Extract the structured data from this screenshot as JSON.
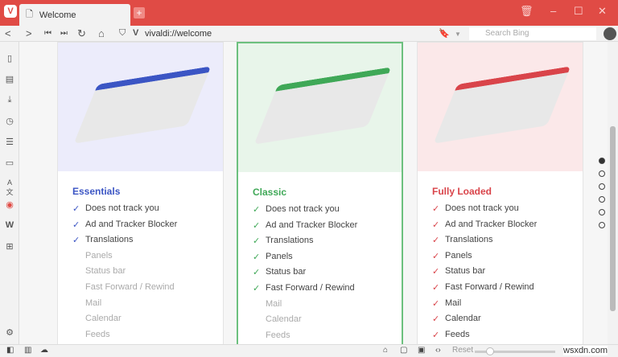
{
  "tab": {
    "title": "Welcome"
  },
  "address": {
    "url": "vivaldi://welcome",
    "search_placeholder": "Search Bing"
  },
  "cards": [
    {
      "title": "Essentials",
      "color": "#3b55c4",
      "bg": "#ececfb",
      "items": [
        {
          "label": "Does not track you",
          "on": true
        },
        {
          "label": "Ad and Tracker Blocker",
          "on": true
        },
        {
          "label": "Translations",
          "on": true
        },
        {
          "label": "Panels",
          "on": false
        },
        {
          "label": "Status bar",
          "on": false
        },
        {
          "label": "Fast Forward / Rewind",
          "on": false
        },
        {
          "label": "Mail",
          "on": false
        },
        {
          "label": "Calendar",
          "on": false
        },
        {
          "label": "Feeds",
          "on": false
        }
      ]
    },
    {
      "title": "Classic",
      "color": "#3fa857",
      "bg": "#e8f5ea",
      "items": [
        {
          "label": "Does not track you",
          "on": true
        },
        {
          "label": "Ad and Tracker Blocker",
          "on": true
        },
        {
          "label": "Translations",
          "on": true
        },
        {
          "label": "Panels",
          "on": true
        },
        {
          "label": "Status bar",
          "on": true
        },
        {
          "label": "Fast Forward / Rewind",
          "on": true
        },
        {
          "label": "Mail",
          "on": false
        },
        {
          "label": "Calendar",
          "on": false
        },
        {
          "label": "Feeds",
          "on": false
        }
      ]
    },
    {
      "title": "Fully Loaded",
      "color": "#d9444a",
      "bg": "#fbe8e9",
      "items": [
        {
          "label": "Does not track you",
          "on": true
        },
        {
          "label": "Ad and Tracker Blocker",
          "on": true
        },
        {
          "label": "Translations",
          "on": true
        },
        {
          "label": "Panels",
          "on": true
        },
        {
          "label": "Status bar",
          "on": true
        },
        {
          "label": "Fast Forward / Rewind",
          "on": true
        },
        {
          "label": "Mail",
          "on": true
        },
        {
          "label": "Calendar",
          "on": true
        },
        {
          "label": "Feeds",
          "on": true
        }
      ]
    }
  ],
  "status": {
    "reset_label": "Reset"
  },
  "watermark": "wsxdn.com"
}
